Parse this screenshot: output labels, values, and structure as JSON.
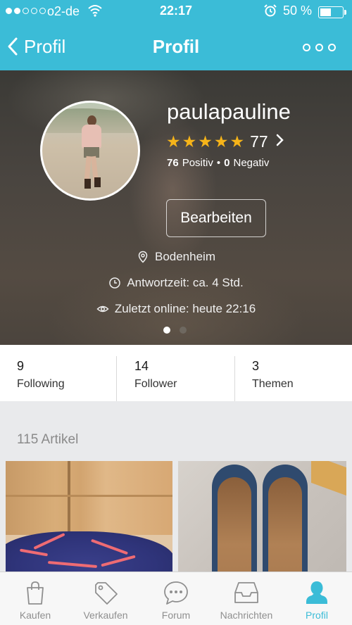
{
  "status": {
    "carrier": "o2-de",
    "time": "22:17",
    "battery": "50 %",
    "battery_level": 0.5
  },
  "nav": {
    "back_label": "Profil",
    "title": "Profil"
  },
  "profile": {
    "username": "paulapauline",
    "stars": 5,
    "rating_count": "77",
    "positive_count": "76",
    "positive_label": "Positiv",
    "negative_count": "0",
    "negative_label": "Negativ",
    "edit_label": "Bearbeiten",
    "location": "Bodenheim",
    "response_time": "Antwortzeit: ca. 4 Std.",
    "last_online": "Zuletzt online: heute 22:16",
    "page_dots": 2,
    "active_dot": 0
  },
  "stats": [
    {
      "value": "9",
      "label": "Following"
    },
    {
      "value": "14",
      "label": "Follower"
    },
    {
      "value": "3",
      "label": "Themen"
    }
  ],
  "articles": {
    "title": "115 Artikel"
  },
  "tabbar": {
    "items": [
      {
        "label": "Kaufen",
        "icon": "shopping-bag-icon"
      },
      {
        "label": "Verkaufen",
        "icon": "price-tag-icon"
      },
      {
        "label": "Forum",
        "icon": "chat-bubble-icon"
      },
      {
        "label": "Nachrichten",
        "icon": "inbox-icon"
      },
      {
        "label": "Profil",
        "icon": "person-icon"
      }
    ],
    "active": 4
  },
  "colors": {
    "accent": "#3bbcd7",
    "star": "#f6b419",
    "inactive_tab": "#8f8f8f"
  }
}
